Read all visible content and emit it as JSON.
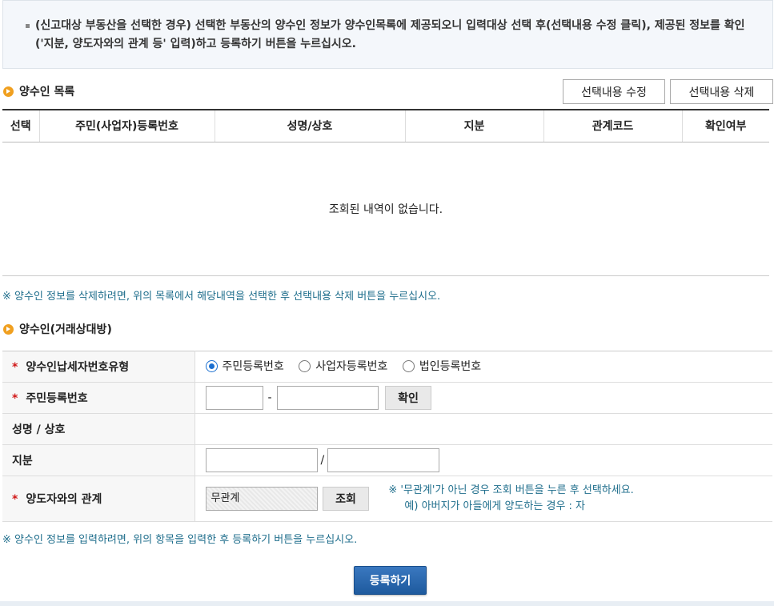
{
  "notice": {
    "text": "(신고대상 부동산을 선택한 경우) 선택한 부동산의 양수인 정보가 양수인목록에 제공되오니 입력대상 선택 후(선택내용 수정 클릭), 제공된 정보를 확인('지분, 양도자와의 관계 등' 입력)하고 등록하기 버튼을 누르십시오."
  },
  "list": {
    "title": "양수인 목록",
    "edit_button": "선택내용 수정",
    "delete_button": "선택내용 삭제",
    "columns": [
      "선택",
      "주민(사업자)등록번호",
      "성명/상호",
      "지분",
      "관계코드",
      "확인여부"
    ],
    "empty_message": "조회된 내역이 없습니다."
  },
  "delete_note": "※ 양수인 정보를 삭제하려면, 위의 목록에서 해당내역을 선택한 후 선택내용 삭제 버튼을 누르십시오.",
  "form": {
    "title": "양수인(거래상대방)",
    "required_mark": "*",
    "taxpayer_type": {
      "label": "양수인납세자번호유형",
      "options": [
        "주민등록번호",
        "사업자등록번호",
        "법인등록번호"
      ],
      "selected": 0
    },
    "resident_no": {
      "label": "주민등록번호",
      "separator": "-",
      "confirm_button": "확인"
    },
    "name": {
      "label": "성명 / 상호"
    },
    "share": {
      "label": "지분",
      "separator": "/"
    },
    "relation": {
      "label": "양도자와의 관계",
      "value": "무관계",
      "lookup_button": "조회",
      "hint_line1": "※ '무관계'가 아닌 경우 조회 버튼을 누른 후 선택하세요.",
      "hint_line2": "예) 아버지가 아들에게 양도하는 경우 : 자"
    }
  },
  "input_note": "※ 양수인 정보를 입력하려면, 위의 항목을 입력한 후 등록하기 버튼을 누르십시오.",
  "submit_button": "등록하기",
  "colors": {
    "accent": "#f0a020",
    "note": "#1f6e8c",
    "required": "#d01818",
    "primary": "#1e5a9e"
  }
}
